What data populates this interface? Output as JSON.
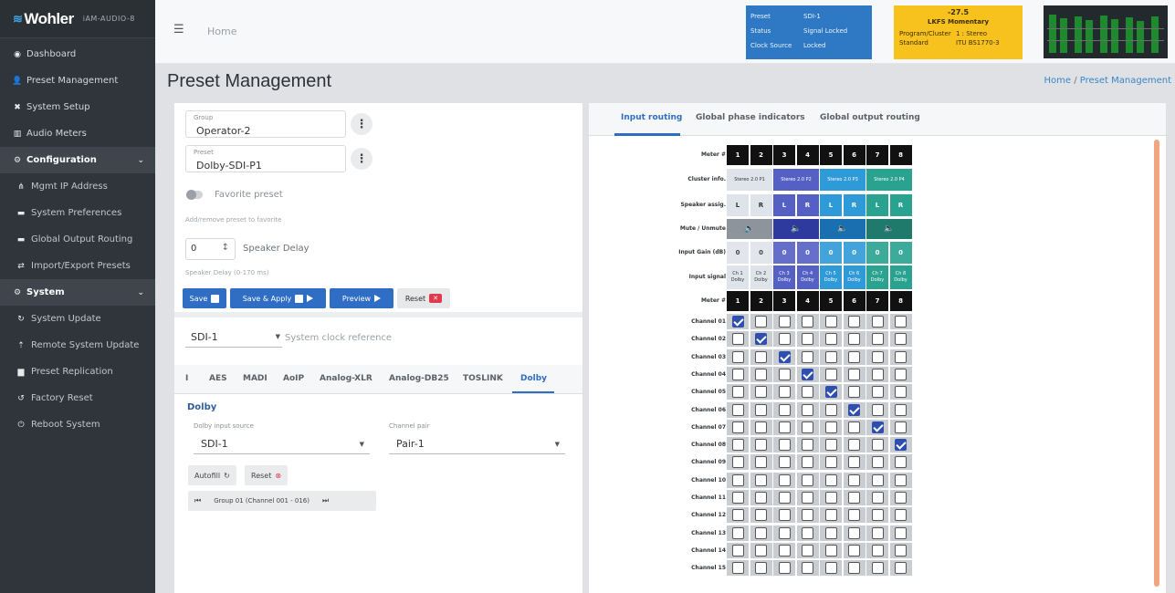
{
  "brand": {
    "name": "Wohler",
    "model": "iAM-AUDIO-8"
  },
  "sidebar": {
    "items": [
      {
        "label": "Dashboard",
        "icon": "dashboard-icon"
      },
      {
        "label": "Preset Management",
        "icon": "user-icon"
      },
      {
        "label": "System Setup",
        "icon": "tools-icon"
      },
      {
        "label": "Audio Meters",
        "icon": "bar-chart-icon"
      },
      {
        "label": "Configuration",
        "icon": "gear-icon",
        "section": true
      },
      {
        "label": "Mgmt IP Address",
        "icon": "network-icon"
      },
      {
        "label": "System Preferences",
        "icon": "sliders-icon"
      },
      {
        "label": "Global Output Routing",
        "icon": "routing-icon"
      },
      {
        "label": "Import/Export Presets",
        "icon": "swap-icon"
      },
      {
        "label": "System",
        "icon": "gears-icon",
        "section": true
      },
      {
        "label": "System Update",
        "icon": "refresh-icon"
      },
      {
        "label": "Remote System Update",
        "icon": "remote-icon"
      },
      {
        "label": "Preset Replication",
        "icon": "copy-icon"
      },
      {
        "label": "Factory Reset",
        "icon": "undo-icon"
      },
      {
        "label": "Reboot System",
        "icon": "power-icon"
      }
    ]
  },
  "topbar": {
    "home": "Home",
    "status": {
      "preset_key": "Preset",
      "preset_val": "SDI-1",
      "status_key": "Status",
      "status_val": "Signal Locked",
      "clock_key": "Clock Source",
      "clock_val": "Locked"
    },
    "loudness": {
      "value": "-27.5",
      "title": "LKFS  Momentary",
      "program_key": "Program/Cluster",
      "program_val": "1 : Stereo",
      "standard_key": "Standard",
      "standard_val": "ITU BS1770-3"
    }
  },
  "page": {
    "title": "Preset Management",
    "crumb_home": "Home",
    "crumb_sep": "/",
    "crumb_current": "Preset Management"
  },
  "left": {
    "group_label": "Group",
    "group_value": "Operator-2",
    "preset_label": "Preset",
    "preset_value": "Dolby-SDI-P1",
    "favorite_label": "Favorite preset",
    "favorite_hint": "Add/remove preset to favorite",
    "delay_value": "0",
    "delay_label": "Speaker Delay",
    "delay_hint": "Speaker Delay (0-170 ms)",
    "buttons": {
      "save": "Save",
      "save_apply": "Save & Apply",
      "preview": "Preview",
      "reset": "Reset"
    },
    "clock_value": "SDI-1",
    "clock_label": "System clock reference",
    "tabs": [
      "I",
      "AES",
      "MADI",
      "AoIP",
      "Analog-XLR",
      "Analog-DB25",
      "TOSLINK",
      "Dolby"
    ],
    "dolby": {
      "heading": "Dolby",
      "input_label": "Dolby input source",
      "input_value": "SDI-1",
      "pair_label": "Channel pair",
      "pair_value": "Pair-1",
      "autofill": "Autofill",
      "reset": "Reset",
      "group_nav": "Group 01 (Channel 001 - 016)"
    }
  },
  "right": {
    "tabs": [
      "Input routing",
      "Global phase indicators",
      "Global output routing"
    ],
    "row_labels": {
      "meter": "Meter #",
      "cluster": "Cluster info.",
      "speaker": "Speaker assig.",
      "mute": "Mute / Unmute",
      "gain": "Input Gain (dB)",
      "signal": "Input signal"
    },
    "meters": [
      "1",
      "2",
      "3",
      "4",
      "5",
      "6",
      "7",
      "8"
    ],
    "clusters": [
      {
        "label": "Stereo 2.0 P1",
        "color": "#dfe3ea",
        "text": "#333333"
      },
      {
        "label": "Stereo 2.0 P2",
        "color": "#5560c4",
        "text": "#ffffff"
      },
      {
        "label": "Stereo 2.0 P3",
        "color": "#2f9ad8",
        "text": "#ffffff"
      },
      {
        "label": "Stereo 2.0 P4",
        "color": "#29a28f",
        "text": "#ffffff"
      }
    ],
    "speakers": [
      "L",
      "R",
      "L",
      "R",
      "L",
      "R",
      "L",
      "R"
    ],
    "gains": [
      "0",
      "0",
      "0",
      "0",
      "0",
      "0",
      "0",
      "0"
    ],
    "signals": [
      "Ch 1 Dolby",
      "Ch 2 Dolby",
      "Ch 3 Dolby",
      "Ch 4 Dolby",
      "Ch 5 Dolby",
      "Ch 6 Dolby",
      "Ch 7 Dolby",
      "Ch 8 Dolby"
    ],
    "channels": [
      {
        "label": "Channel 01",
        "checked": 0
      },
      {
        "label": "Channel 02",
        "checked": 1
      },
      {
        "label": "Channel 03",
        "checked": 2
      },
      {
        "label": "Channel 04",
        "checked": 3
      },
      {
        "label": "Channel 05",
        "checked": 4
      },
      {
        "label": "Channel 06",
        "checked": 5
      },
      {
        "label": "Channel 07",
        "checked": 6
      },
      {
        "label": "Channel 08",
        "checked": 7
      },
      {
        "label": "Channel 09",
        "checked": -1
      },
      {
        "label": "Channel 10",
        "checked": -1
      },
      {
        "label": "Channel 11",
        "checked": -1
      },
      {
        "label": "Channel 12",
        "checked": -1
      },
      {
        "label": "Channel 13",
        "checked": -1
      },
      {
        "label": "Channel 14",
        "checked": -1
      },
      {
        "label": "Channel 15",
        "checked": -1
      }
    ]
  }
}
